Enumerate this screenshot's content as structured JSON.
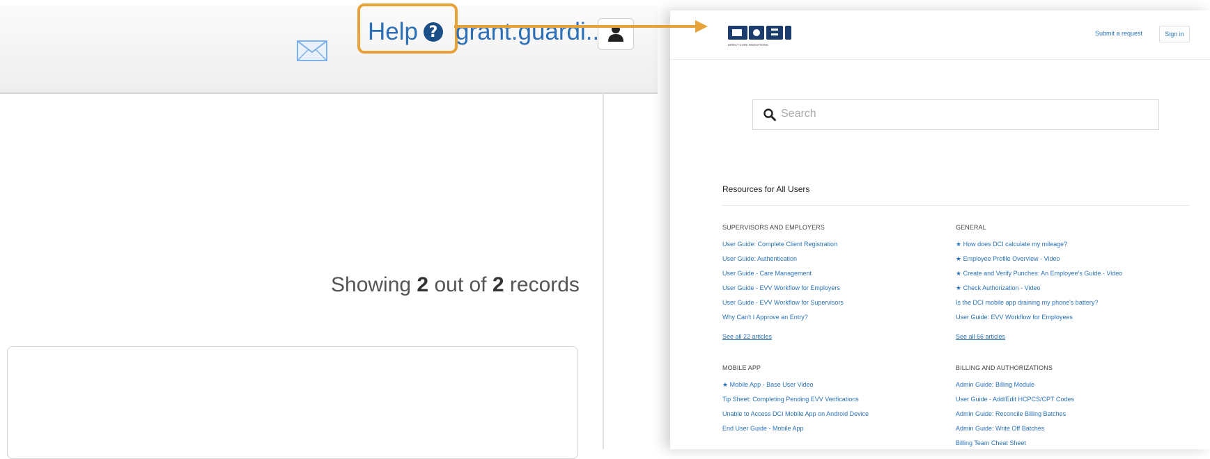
{
  "left_app": {
    "help_label": "Help",
    "username": "grant.guardi...",
    "records": {
      "prefix": "Showing",
      "shown": "2",
      "middle": "out of",
      "total": "2",
      "suffix": "records"
    }
  },
  "help_center": {
    "logo_caption": "DIRECT CARE INNOVATIONS",
    "submit_request": "Submit a request",
    "sign_in": "Sign in",
    "search_placeholder": "Search",
    "resources_title": "Resources for All Users",
    "sections": [
      {
        "title": "SUPERVISORS AND EMPLOYERS",
        "articles": [
          "User Guide: Complete Client Registration",
          "User Guide: Authentication",
          "User Guide - Care Management",
          "User Guide - EVV Workflow for Employers",
          "User Guide - EVV Workflow for Supervisors",
          "Why Can't I Approve an Entry?"
        ],
        "see_all": "See all 22 articles"
      },
      {
        "title": "GENERAL",
        "articles": [
          "★ How does DCI calculate my mileage?",
          "★ Employee Profile Overview - Video",
          "★ Create and Verify Punches: An Employee's Guide - Video",
          "★ Check Authorization - Video",
          "Is the DCI mobile app draining my phone's battery?",
          "User Guide: EVV Workflow for Employees"
        ],
        "see_all": "See all 66 articles"
      },
      {
        "title": "MOBILE APP",
        "articles": [
          "★ Mobile App - Base User Video",
          "Tip Sheet: Completing Pending EVV Verifications",
          "Unable to Access DCI Mobile App on Android Device",
          "End User Guide - Mobile App"
        ]
      },
      {
        "title": "BILLING AND AUTHORIZATIONS",
        "articles": [
          "Admin Guide: Billing Module",
          "User Guide - Add/Edit HCPCS/CPT Codes",
          "Admin Guide: Reconcile Billing Batches",
          "Admin Guide: Write Off Batches",
          "Billing Team Cheat Sheet"
        ]
      }
    ]
  },
  "colors": {
    "highlight": "#e8a23a",
    "link": "#2a72b8",
    "app_link": "#2c6fb7"
  },
  "icons": [
    "mail-icon",
    "help-circle-icon",
    "user-icon",
    "search-icon",
    "dci-logo"
  ]
}
